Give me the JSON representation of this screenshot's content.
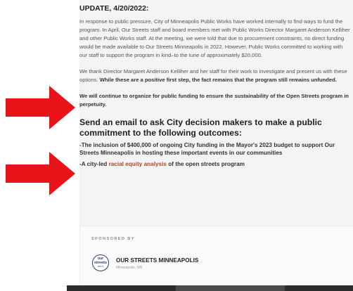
{
  "update": {
    "heading": "UPDATE, 4/20/2022:",
    "para1": "In response to public pressure, City of Minneapolis Public Works have worked internally to find ways to fund the program. In April, Our Streets staff and board members met with Public Works Director Margaret Anderson Kelliher and other Public Works staff. At the meeting, we were told that due to procurement constraints, no direct funding would be made available to Our Streets Minneapolis in 2022. However, Public Works committed to working with our staff to support the program in kind–to the tune of approximately $20,000.",
    "para2_normal": "We thank Director Margaret Anderson Kelliher and her staff for their work to investigate and present us with these options.",
    "para2_bold": "While these are a positive first step, the fact remains that the program still remains unfunded.",
    "para3": "We will continue to organize for public funding to ensure the sustainability of the Open Streets program in perpetuity."
  },
  "cta": {
    "heading": "Send an email to ask City decision makers to make a public commitment to the following outcomes:",
    "outcome1": "-The inclusion of $400,000 of ongoing City funding in the Mayor's 2023 budget to support Our Streets Minneapolis in hosting these important events in our communities",
    "outcome2_prefix": "-A city-led",
    "outcome2_link": "racial equity analysis",
    "outcome2_suffix": "of the open streets program"
  },
  "sponsor": {
    "label": "SPONSORED BY",
    "logo_line1": "our",
    "logo_line2": "streets",
    "logo_line3": "MPLS",
    "name": "OUR STREETS MINNEAPOLIS",
    "location": "Minneapolis, MN"
  },
  "colors": {
    "arrow": "#e8141a",
    "link": "#b8432a",
    "logo": "#2e3e7e"
  }
}
